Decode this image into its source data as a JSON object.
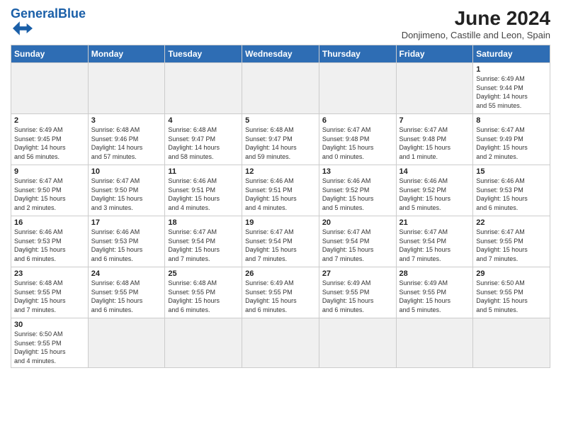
{
  "header": {
    "logo_general": "General",
    "logo_blue": "Blue",
    "month_title": "June 2024",
    "subtitle": "Donjimeno, Castille and Leon, Spain"
  },
  "days_of_week": [
    "Sunday",
    "Monday",
    "Tuesday",
    "Wednesday",
    "Thursday",
    "Friday",
    "Saturday"
  ],
  "weeks": [
    [
      {
        "day": "",
        "info": ""
      },
      {
        "day": "",
        "info": ""
      },
      {
        "day": "",
        "info": ""
      },
      {
        "day": "",
        "info": ""
      },
      {
        "day": "",
        "info": ""
      },
      {
        "day": "",
        "info": ""
      },
      {
        "day": "1",
        "info": "Sunrise: 6:49 AM\nSunset: 9:44 PM\nDaylight: 14 hours\nand 55 minutes."
      }
    ],
    [
      {
        "day": "2",
        "info": "Sunrise: 6:49 AM\nSunset: 9:45 PM\nDaylight: 14 hours\nand 56 minutes."
      },
      {
        "day": "3",
        "info": "Sunrise: 6:48 AM\nSunset: 9:46 PM\nDaylight: 14 hours\nand 57 minutes."
      },
      {
        "day": "4",
        "info": "Sunrise: 6:48 AM\nSunset: 9:47 PM\nDaylight: 14 hours\nand 58 minutes."
      },
      {
        "day": "5",
        "info": "Sunrise: 6:48 AM\nSunset: 9:47 PM\nDaylight: 14 hours\nand 59 minutes."
      },
      {
        "day": "6",
        "info": "Sunrise: 6:47 AM\nSunset: 9:48 PM\nDaylight: 15 hours\nand 0 minutes."
      },
      {
        "day": "7",
        "info": "Sunrise: 6:47 AM\nSunset: 9:48 PM\nDaylight: 15 hours\nand 1 minute."
      },
      {
        "day": "8",
        "info": "Sunrise: 6:47 AM\nSunset: 9:49 PM\nDaylight: 15 hours\nand 2 minutes."
      }
    ],
    [
      {
        "day": "9",
        "info": "Sunrise: 6:47 AM\nSunset: 9:50 PM\nDaylight: 15 hours\nand 2 minutes."
      },
      {
        "day": "10",
        "info": "Sunrise: 6:47 AM\nSunset: 9:50 PM\nDaylight: 15 hours\nand 3 minutes."
      },
      {
        "day": "11",
        "info": "Sunrise: 6:46 AM\nSunset: 9:51 PM\nDaylight: 15 hours\nand 4 minutes."
      },
      {
        "day": "12",
        "info": "Sunrise: 6:46 AM\nSunset: 9:51 PM\nDaylight: 15 hours\nand 4 minutes."
      },
      {
        "day": "13",
        "info": "Sunrise: 6:46 AM\nSunset: 9:52 PM\nDaylight: 15 hours\nand 5 minutes."
      },
      {
        "day": "14",
        "info": "Sunrise: 6:46 AM\nSunset: 9:52 PM\nDaylight: 15 hours\nand 5 minutes."
      },
      {
        "day": "15",
        "info": "Sunrise: 6:46 AM\nSunset: 9:53 PM\nDaylight: 15 hours\nand 6 minutes."
      }
    ],
    [
      {
        "day": "16",
        "info": "Sunrise: 6:46 AM\nSunset: 9:53 PM\nDaylight: 15 hours\nand 6 minutes."
      },
      {
        "day": "17",
        "info": "Sunrise: 6:46 AM\nSunset: 9:53 PM\nDaylight: 15 hours\nand 6 minutes."
      },
      {
        "day": "18",
        "info": "Sunrise: 6:47 AM\nSunset: 9:54 PM\nDaylight: 15 hours\nand 7 minutes."
      },
      {
        "day": "19",
        "info": "Sunrise: 6:47 AM\nSunset: 9:54 PM\nDaylight: 15 hours\nand 7 minutes."
      },
      {
        "day": "20",
        "info": "Sunrise: 6:47 AM\nSunset: 9:54 PM\nDaylight: 15 hours\nand 7 minutes."
      },
      {
        "day": "21",
        "info": "Sunrise: 6:47 AM\nSunset: 9:54 PM\nDaylight: 15 hours\nand 7 minutes."
      },
      {
        "day": "22",
        "info": "Sunrise: 6:47 AM\nSunset: 9:55 PM\nDaylight: 15 hours\nand 7 minutes."
      }
    ],
    [
      {
        "day": "23",
        "info": "Sunrise: 6:48 AM\nSunset: 9:55 PM\nDaylight: 15 hours\nand 7 minutes."
      },
      {
        "day": "24",
        "info": "Sunrise: 6:48 AM\nSunset: 9:55 PM\nDaylight: 15 hours\nand 6 minutes."
      },
      {
        "day": "25",
        "info": "Sunrise: 6:48 AM\nSunset: 9:55 PM\nDaylight: 15 hours\nand 6 minutes."
      },
      {
        "day": "26",
        "info": "Sunrise: 6:49 AM\nSunset: 9:55 PM\nDaylight: 15 hours\nand 6 minutes."
      },
      {
        "day": "27",
        "info": "Sunrise: 6:49 AM\nSunset: 9:55 PM\nDaylight: 15 hours\nand 6 minutes."
      },
      {
        "day": "28",
        "info": "Sunrise: 6:49 AM\nSunset: 9:55 PM\nDaylight: 15 hours\nand 5 minutes."
      },
      {
        "day": "29",
        "info": "Sunrise: 6:50 AM\nSunset: 9:55 PM\nDaylight: 15 hours\nand 5 minutes."
      }
    ],
    [
      {
        "day": "30",
        "info": "Sunrise: 6:50 AM\nSunset: 9:55 PM\nDaylight: 15 hours\nand 4 minutes."
      },
      {
        "day": "",
        "info": ""
      },
      {
        "day": "",
        "info": ""
      },
      {
        "day": "",
        "info": ""
      },
      {
        "day": "",
        "info": ""
      },
      {
        "day": "",
        "info": ""
      },
      {
        "day": "",
        "info": ""
      }
    ]
  ]
}
